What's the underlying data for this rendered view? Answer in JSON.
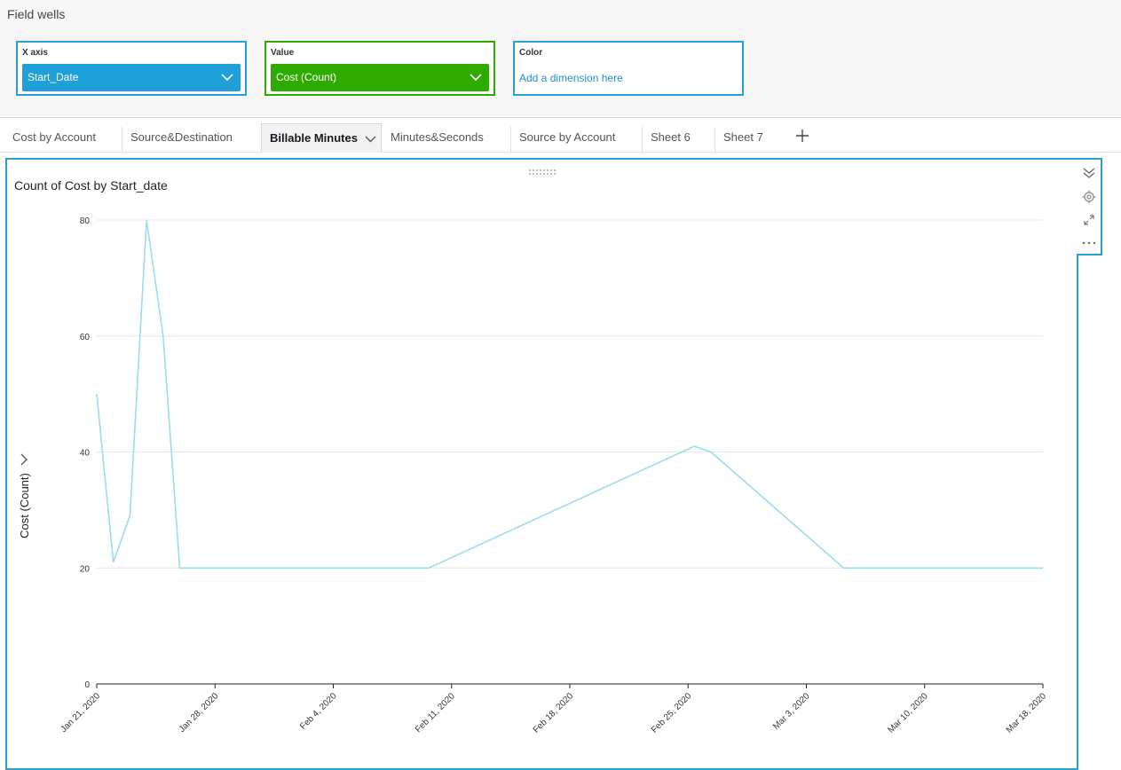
{
  "field_wells": {
    "title": "Field wells",
    "x_axis": {
      "label": "X axis",
      "field": "Start_Date"
    },
    "value": {
      "label": "Value",
      "field": "Cost (Count)"
    },
    "color": {
      "label": "Color",
      "placeholder": "Add a dimension here"
    }
  },
  "tabs": [
    {
      "label": "Cost by Account",
      "active": false
    },
    {
      "label": "Source&Destination",
      "active": false
    },
    {
      "label": "Billable Minutes",
      "active": true
    },
    {
      "label": "Minutes&Seconds",
      "active": false
    },
    {
      "label": "Source by Account",
      "active": false
    },
    {
      "label": "Sheet 6",
      "active": false
    },
    {
      "label": "Sheet 7",
      "active": false
    }
  ],
  "colors": {
    "accent": "#2a9fd6",
    "value_well": "#2eaa00",
    "line": "#9bdcee"
  },
  "icons": [
    "chevron-down-icon",
    "plus-icon",
    "drag-handle-icon",
    "collapse-icon",
    "gear-icon",
    "expand-icon",
    "more-icon",
    "axis-chevron-icon"
  ],
  "chart_data": {
    "type": "line",
    "title": "Count of Cost by Start_date",
    "xlabel": "",
    "ylabel": "Cost (Count)",
    "ylim": [
      0,
      80
    ],
    "yticks": [
      0,
      20,
      40,
      60,
      80
    ],
    "xticks": [
      "Jan 21, 2020",
      "Jan 28, 2020",
      "Feb 4, 2020",
      "Feb 11, 2020",
      "Feb 18, 2020",
      "Feb 25, 2020",
      "Mar 3, 2020",
      "Mar 10, 2020",
      "Mar 18, 2020"
    ],
    "grid": true,
    "series": [
      {
        "points": [
          [
            "2020-01-21",
            50
          ],
          [
            "2020-01-22",
            21
          ],
          [
            "2020-01-23",
            29
          ],
          [
            "2020-01-24",
            80
          ],
          [
            "2020-01-25",
            60
          ],
          [
            "2020-01-26",
            20
          ],
          [
            "2020-02-10",
            20
          ],
          [
            "2020-02-26",
            41
          ],
          [
            "2020-02-27",
            40
          ],
          [
            "2020-03-06",
            20
          ],
          [
            "2020-03-18",
            20
          ]
        ]
      }
    ]
  }
}
